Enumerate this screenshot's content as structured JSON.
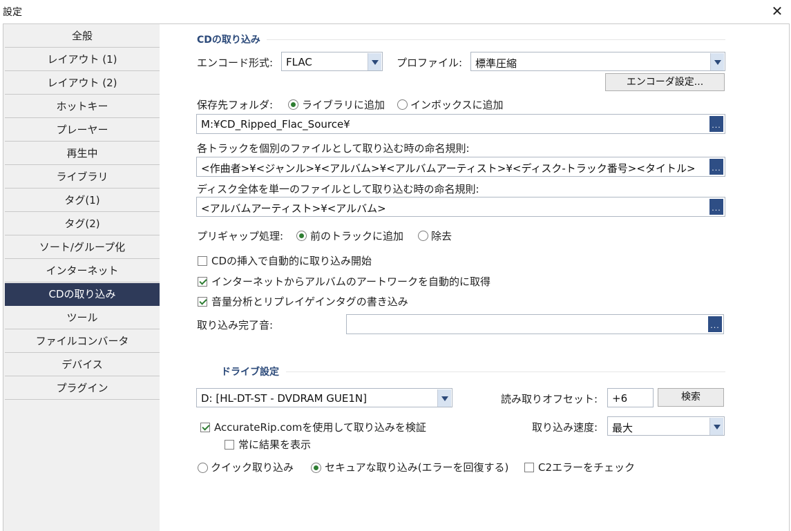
{
  "window": {
    "title": "設定",
    "close_glyph": "✕"
  },
  "sidebar": {
    "items": [
      {
        "label": "全般"
      },
      {
        "label": "レイアウト (1)"
      },
      {
        "label": "レイアウト (2)"
      },
      {
        "label": "ホットキー"
      },
      {
        "label": "プレーヤー"
      },
      {
        "label": "再生中"
      },
      {
        "label": "ライブラリ"
      },
      {
        "label": "タグ(1)"
      },
      {
        "label": "タグ(2)"
      },
      {
        "label": "ソート/グループ化"
      },
      {
        "label": "インターネット"
      },
      {
        "label": "CDの取り込み",
        "active": true
      },
      {
        "label": "ツール"
      },
      {
        "label": "ファイルコンバータ"
      },
      {
        "label": "デバイス"
      },
      {
        "label": "プラグイン"
      }
    ]
  },
  "cd_rip": {
    "section_title": "CDの取り込み",
    "encode_format_label": "エンコード形式:",
    "encode_format_value": "FLAC",
    "profile_label": "プロファイル:",
    "profile_value": "標準圧縮",
    "encoder_settings_button": "エンコーダ設定...",
    "save_folder_label": "保存先フォルダ:",
    "radio_library": "ライブラリに追加",
    "radio_inbox": "インボックスに追加",
    "folder_path": "M:¥CD_Ripped_Flac_Source¥",
    "track_naming_label": "各トラックを個別のファイルとして取り込む時の命名規則:",
    "track_naming_value": "<作曲者>¥<ジャンル>¥<アルバム>¥<アルバムアーティスト>¥<ディスク-トラック番号><タイトル>",
    "disc_naming_label": "ディスク全体を単一のファイルとして取り込む時の命名規則:",
    "disc_naming_value": "<アルバムアーティスト>¥<アルバム>",
    "pregap_label": "プリギャップ処理:",
    "pregap_add": "前のトラックに追加",
    "pregap_remove": "除去",
    "auto_rip_label": "CDの挿入で自動的に取り込み開始",
    "artwork_label": "インターネットからアルバムのアートワークを自動的に取得",
    "replaygain_label": "音量分析とリプレイゲインタグの書き込み",
    "complete_sound_label": "取り込み完了音:",
    "complete_sound_value": "",
    "browse_glyph": "..."
  },
  "drive": {
    "section_title": "ドライブ設定",
    "drive_value": "D: [HL-DT-ST - DVDRAM GUE1N]",
    "offset_label": "読み取りオフセット:",
    "offset_value": "+6",
    "search_button": "検索",
    "accuraterip_label": "AccurateRip.comを使用して取り込みを検証",
    "show_results_label": "常に結果を表示",
    "speed_label": "取り込み速度:",
    "speed_value": "最大",
    "quick_rip_label": "クイック取り込み",
    "secure_rip_label": "セキュアな取り込み(エラーを回復する)",
    "c2_label": "C2エラーをチェック"
  }
}
